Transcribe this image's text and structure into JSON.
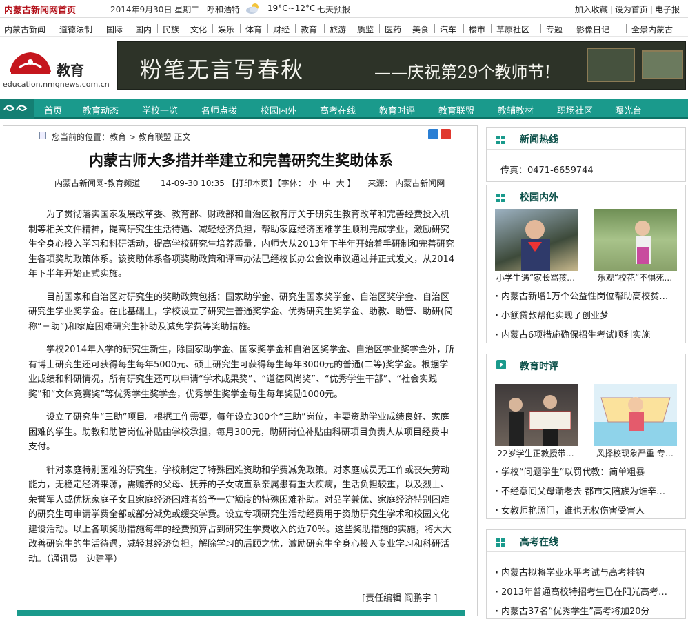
{
  "topbar": {
    "home_link": "内蒙古新闻网首页",
    "date": "2014年9月30日 星期二",
    "city": "呼和浩特",
    "temperature": "19°C~12°C",
    "forecast": "七天预报",
    "links": [
      "加入收藏",
      "设为首页",
      "电子报"
    ],
    "weather_icon": "cloud-sun-icon"
  },
  "nav": [
    "内蒙古新闻",
    "道德法制",
    "国际",
    "国内",
    "民族",
    "文化",
    "娱乐",
    "体育",
    "财经",
    "教育",
    "旅游",
    "质监",
    "医药",
    "美食",
    "汽车",
    "楼市",
    "草原社区",
    "专题",
    "影像日记",
    "全景内蒙古"
  ],
  "brand": {
    "channel": "教育",
    "url": "education.nmgnews.com.cn"
  },
  "banner": {
    "title": "粉笔无言写春秋",
    "subtitle": "——庆祝第29个教师节!"
  },
  "mainnav": [
    "首页",
    "教育动态",
    "学校一览",
    "名师点拨",
    "校园内外",
    "高考在线",
    "教育时评",
    "教育联盟",
    "教辅教材",
    "职场社区",
    "曝光台"
  ],
  "article": {
    "breadcrumb": "您当前的位置：教育 > 教育联盟 正文",
    "title": "内蒙古师大多措并举建立和完善研究生奖助体系",
    "source_site": "内蒙古新闻网-教育频道",
    "datetime": "14-09-30 10:35",
    "print": "【打印本页】",
    "font_label": "【字体：",
    "font_sizes": [
      "小",
      "中",
      "大"
    ],
    "font_close": "】",
    "source_label": "来源：",
    "source": "内蒙古新闻网",
    "paragraphs": [
      "为了贯彻落实国家发展改革委、教育部、财政部和自治区教育厅关于研究生教育改革和完善经费投入机制等相关文件精神，提高研究生生活待遇、减轻经济负担，帮助家庭经济困难学生顺利完成学业，激励研究生全身心投入学习和科研活动，提高学校研究生培养质量，内师大从2013年下半年开始着手研制和完善研究生各项奖助政策体系。该资助体系各项奖助政策和评审办法已经校长办公会议审议通过并正式发文，从2014年下半年开始正式实施。",
      "目前国家和自治区对研究生的奖助政策包括：国家助学金、研究生国家奖学金、自治区奖学金、自治区研究生学业奖学金。在此基础上，学校设立了研究生普通奖学金、优秀研究生奖学金、助教、助管、助研(简称“三助”)和家庭困难研究生补助及减免学费等奖助措施。",
      "学校2014年入学的研究生新生，除国家助学金、国家奖学金和自治区奖学金、自治区学业奖学金外，所有博士研究生还可获得每生每年5000元、硕士研究生可获得每生每年3000元的普通(二等)奖学金。根据学业成绩和科研情况，所有研究生还可以申请“学术成果奖”、“道德风尚奖”、“优秀学生干部”、“社会实践奖”和“文体竞赛奖”等优秀学生奖学金，优秀学生奖学金每生每年奖励1000元。",
      "设立了研究生“三助”项目。根据工作需要，每年设立300个“三助”岗位，主要资助学业成绩良好、家庭困难的学生。助教和助管岗位补贴由学校承担，每月300元，助研岗位补贴由科研项目负责人从项目经费中支付。",
      "针对家庭特别困难的研究生，学校制定了特殊困难资助和学费减免政策。对家庭成员无工作或丧失劳动能力，无稳定经济来源，需赡养的父母、抚养的子女或直系亲属患有重大疾病，生活负担较重，以及烈士、荣誉军人或优抚家庭子女且家庭经济困难者给予一定额度的特殊困难补助。对品学兼优、家庭经济特别困难的研究生可申请学费全部或部分减免或缓交学费。设立专项研究生活动经费用于资助研究生学术和校园文化建设活动。以上各项奖助措施每年的经费预算占到研究生学费收入的近70%。这些奖助措施的实施，将大大改善研究生的生活待遇，减轻其经济负担，解除学习的后顾之忧，激励研究生全身心投入专业学习和科研活动。（通讯员　边建平）"
    ],
    "editor": "[责任编辑 阎鹏宇 ]"
  },
  "sidebar": {
    "hotline": {
      "title": "新闻热线",
      "fax": "传真：0471-6659744"
    },
    "campus": {
      "title": "校园内外",
      "photos": [
        "小学生遇“家长骂孩…",
        "乐观“校花”不惧死…"
      ],
      "items": [
        "内蒙古新增1万个公益性岗位帮助高校贫…",
        "小额贷款帮他实现了创业梦",
        "内蒙古6项措施确保招生考试顺利实施"
      ]
    },
    "commentary": {
      "title": "教育时评",
      "photos": [
        "22岁学生正教授带…",
        "风择校现象严重 专…"
      ],
      "items": [
        "学校“问题学生”以罚代教：简单粗暴",
        "不经意间父母渐老去 都市失陪族为谁辛…",
        "女教师艳照门，谁也无权伤害受害人"
      ]
    },
    "gaokao": {
      "title": "高考在线",
      "items": [
        "内蒙古拟将学业水平考试与高考挂钩",
        "2013年普通高校特招考生已在阳光高考…",
        "内蒙古37名“优秀学生”高考将加20分"
      ]
    }
  },
  "colors": {
    "brand_red": "#b3121b",
    "nav_teal": "#1a9a8c",
    "dark_teal": "#0b4f48",
    "banner_bg": "#2d3328"
  }
}
